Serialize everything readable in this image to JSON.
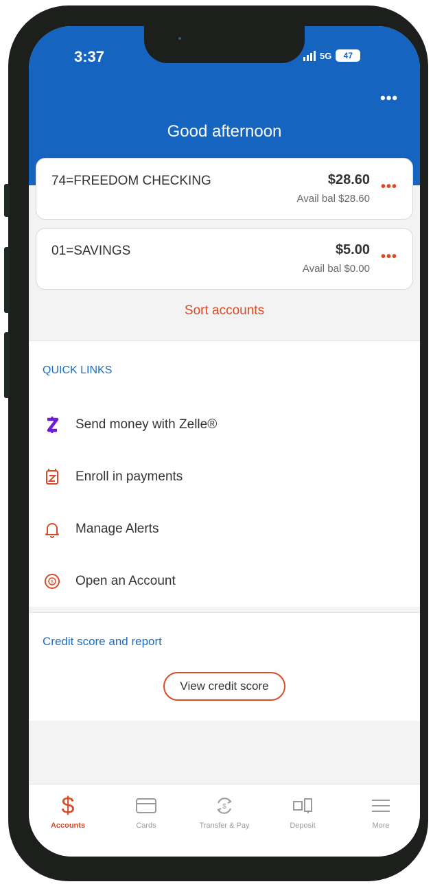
{
  "status_bar": {
    "time": "3:37",
    "network": "5G",
    "battery": "47"
  },
  "header": {
    "more_label": "•••",
    "greeting": "Good afternoon"
  },
  "accounts": [
    {
      "name": "74=FREEDOM CHECKING",
      "balance": "$28.60",
      "available": "Avail bal $28.60",
      "menu_label": "•••"
    },
    {
      "name": "01=SAVINGS",
      "balance": "$5.00",
      "available": "Avail bal $0.00",
      "menu_label": "•••"
    }
  ],
  "sort_accounts_label": "Sort accounts",
  "quick_links": {
    "title": "QUICK LINKS",
    "items": [
      {
        "label": "Send money with Zelle®",
        "icon": "zelle-icon"
      },
      {
        "label": "Enroll in payments",
        "icon": "payments-icon"
      },
      {
        "label": "Manage Alerts",
        "icon": "bell-icon"
      },
      {
        "label": "Open an Account",
        "icon": "open-account-icon"
      }
    ]
  },
  "credit": {
    "title": "Credit score and report",
    "button_label": "View credit score"
  },
  "tabbar": {
    "tabs": [
      {
        "label": "Accounts",
        "icon": "dollar-icon",
        "active": true
      },
      {
        "label": "Cards",
        "icon": "card-icon",
        "active": false
      },
      {
        "label": "Transfer & Pay",
        "icon": "transfer-icon",
        "active": false
      },
      {
        "label": "Deposit",
        "icon": "deposit-icon",
        "active": false
      },
      {
        "label": "More",
        "icon": "menu-icon",
        "active": false
      }
    ]
  },
  "colors": {
    "brand_blue": "#1565c0",
    "accent_orange": "#d94a26",
    "link_blue": "#1a6fc4",
    "zelle_purple": "#6d1ed4"
  }
}
